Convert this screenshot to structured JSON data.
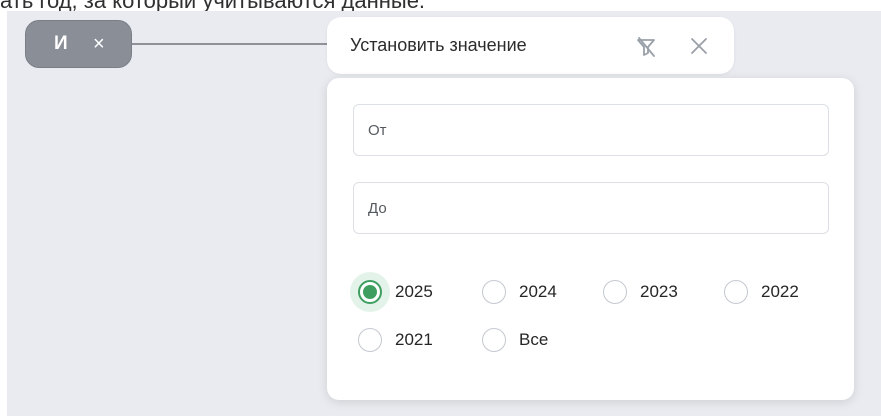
{
  "caption": "ать год, за который учитываются данные.",
  "and_chip": {
    "label": "И",
    "close_glyph": "×"
  },
  "condition": {
    "label": "Установить значение",
    "filter_icon": "filter-off-icon",
    "close_icon": "close-icon"
  },
  "panel": {
    "from_placeholder": "От",
    "to_placeholder": "До",
    "years": [
      "2025",
      "2024",
      "2023",
      "2022",
      "2021",
      "Все"
    ],
    "selected": "2025",
    "accent_color": "#3e9e5f"
  }
}
